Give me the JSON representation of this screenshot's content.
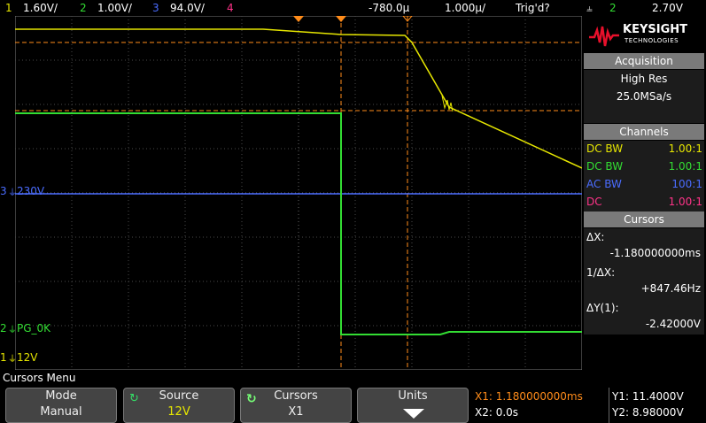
{
  "top_bar": {
    "ch1_num": "1",
    "ch1_scale": "1.60V/",
    "ch2_num": "2",
    "ch2_scale": "1.00V/",
    "ch3_num": "3",
    "ch3_scale": "94.0V/",
    "ch4_num": "4",
    "time_offset": "-780.0µ",
    "time_scale": "1.000µ/",
    "trigger_status": "Trig'd?",
    "trigger_slope_icon": "⫨",
    "trigger_source": "2",
    "trigger_level": "2.70V"
  },
  "colors": {
    "ch1": "#e6e600",
    "ch2": "#33dd33",
    "ch3": "#4a6cff",
    "ch4": "#ff3388",
    "cursor": "#ff8c1a"
  },
  "logo": {
    "brand": "KEYSIGHT",
    "sub": "TECHNOLOGIES"
  },
  "acquisition": {
    "title": "Acquisition",
    "mode": "High Res",
    "rate": "25.0MSa/s"
  },
  "channels": {
    "title": "Channels",
    "items": [
      {
        "coupling": "DC BW",
        "probe": "1.00:1"
      },
      {
        "coupling": "DC BW",
        "probe": "1.00:1"
      },
      {
        "coupling": "AC BW",
        "probe": "100:1"
      },
      {
        "coupling": "DC",
        "probe": "1.00:1"
      }
    ]
  },
  "cursors": {
    "title": "Cursors",
    "dx_label": "ΔX:",
    "dx_value": "-1.180000000ms",
    "inv_dx_label": "1/ΔX:",
    "inv_dx_value": "+847.46Hz",
    "dy_label": "ΔY(1):",
    "dy_value": "-2.42000V"
  },
  "traces": {
    "ch3_label": "230V",
    "ch2_label": "PG_0K",
    "ch1_label": "12V"
  },
  "menu": {
    "title": "Cursors Menu",
    "mode": {
      "label": "Mode",
      "value": "Manual"
    },
    "source": {
      "label": "Source",
      "value": "12V"
    },
    "cursors": {
      "label": "Cursors",
      "value": "X1"
    },
    "units": {
      "label": "Units"
    }
  },
  "readouts": {
    "x1": "X1: 1.180000000ms",
    "x2": "X2: 0.0s",
    "y1": "Y1: 11.4000V",
    "y2": "Y2: 8.98000V"
  }
}
